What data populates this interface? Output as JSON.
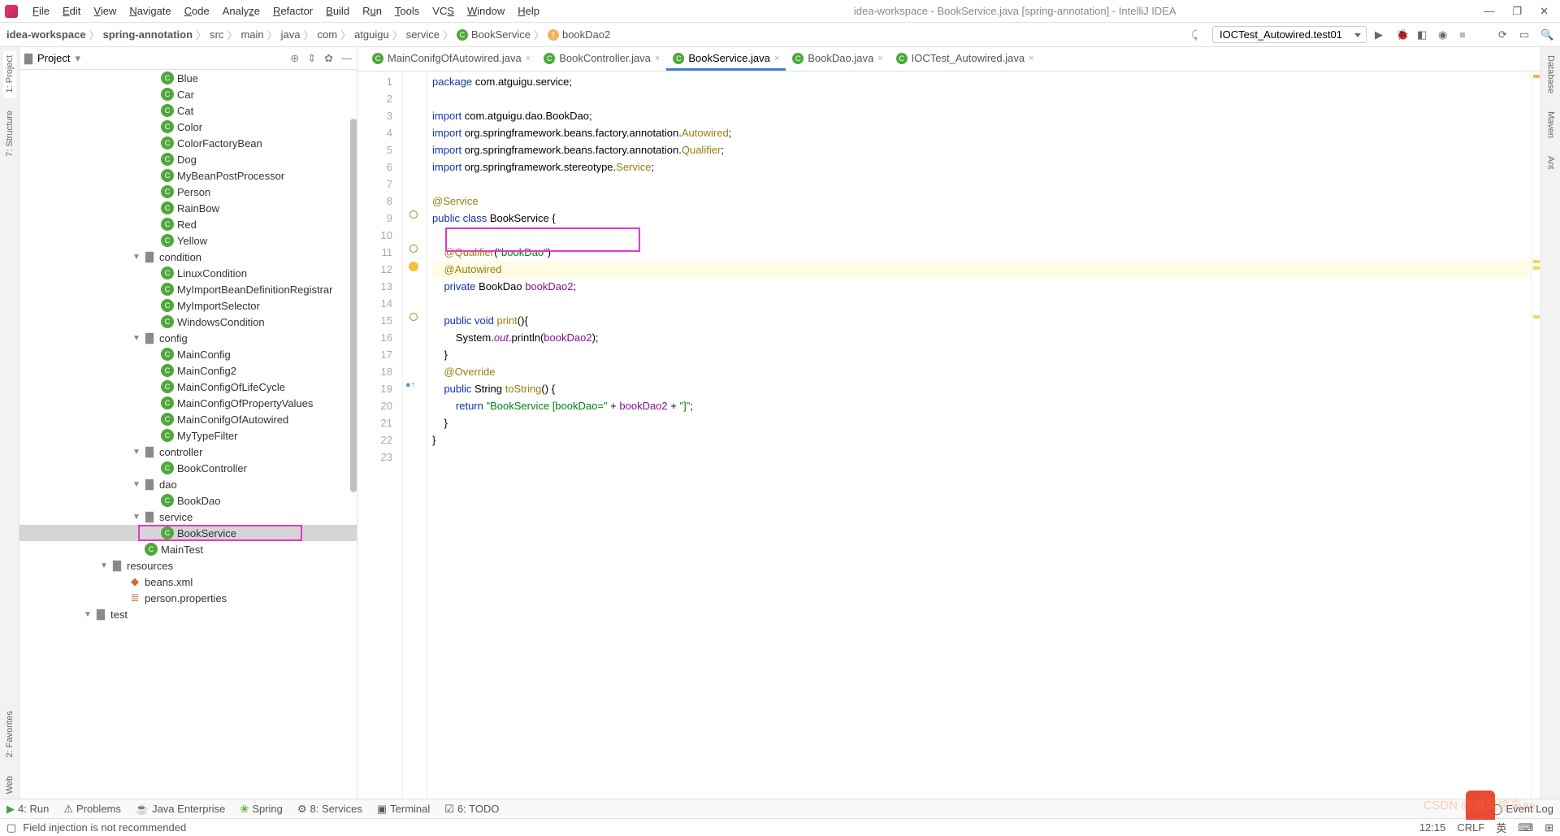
{
  "title": "idea-workspace - BookService.java [spring-annotation] - IntelliJ IDEA",
  "menu": [
    "File",
    "Edit",
    "View",
    "Navigate",
    "Code",
    "Analyze",
    "Refactor",
    "Build",
    "Run",
    "Tools",
    "VCS",
    "Window",
    "Help"
  ],
  "breadcrumb": [
    "idea-workspace",
    "spring-annotation",
    "src",
    "main",
    "java",
    "com",
    "atguigu",
    "service",
    "BookService",
    "bookDao2"
  ],
  "run_config": "IOCTest_Autowired.test01",
  "project_panel_title": "Project",
  "tree": {
    "bean": [
      "Blue",
      "Car",
      "Cat",
      "Color",
      "ColorFactoryBean",
      "Dog",
      "MyBeanPostProcessor",
      "Person",
      "RainBow",
      "Red",
      "Yellow"
    ],
    "condition_label": "condition",
    "condition": [
      "LinuxCondition",
      "MyImportBeanDefinitionRegistrar",
      "MyImportSelector",
      "WindowsCondition"
    ],
    "config_label": "config",
    "config": [
      "MainConfig",
      "MainConfig2",
      "MainConfigOfLifeCycle",
      "MainConfigOfPropertyValues",
      "MainConifgOfAutowired",
      "MyTypeFilter"
    ],
    "controller_label": "controller",
    "controller": [
      "BookController"
    ],
    "dao_label": "dao",
    "dao": [
      "BookDao"
    ],
    "service_label": "service",
    "service": [
      "BookService"
    ],
    "maintest": "MainTest",
    "resources_label": "resources",
    "resources": [
      "beans.xml",
      "person.properties"
    ],
    "test_label": "test"
  },
  "editor_tabs": [
    {
      "name": "MainConifgOfAutowired.java"
    },
    {
      "name": "BookController.java"
    },
    {
      "name": "BookService.java",
      "active": true
    },
    {
      "name": "BookDao.java"
    },
    {
      "name": "IOCTest_Autowired.java"
    }
  ],
  "left_tabs": [
    "1: Project",
    "7: Structure",
    "2: Favorites",
    "Web"
  ],
  "right_tabs": [
    "Database",
    "Maven",
    "Ant"
  ],
  "bottom_tools": [
    "4: Run",
    "Problems",
    "Java Enterprise",
    "Spring",
    "8: Services",
    "Terminal",
    "6: TODO"
  ],
  "event_log": "Event Log",
  "status_msg": "Field injection is not recommended",
  "cursor": "12:15",
  "line_ending": "CRLF",
  "code": {
    "l1_a": "package",
    "l1_b": " com.atguigu.service;",
    "l3_a": "import",
    "l3_b": " com.atguigu.dao.BookDao;",
    "l4_a": "import",
    "l4_b": " org.springframework.beans.factory.annotation.",
    "l4_c": "Autowired",
    "l4_d": ";",
    "l5_a": "import",
    "l5_b": " org.springframework.beans.factory.annotation.",
    "l5_c": "Qualifier",
    "l5_d": ";",
    "l6_a": "import",
    "l6_b": " org.springframework.stereotype.",
    "l6_c": "Service",
    "l6_d": ";",
    "l8": "@Service",
    "l9_a": "public class ",
    "l9_b": "BookService {",
    "l11_a": "@Qualifier",
    "l11_b": "(",
    "l11_c": "\"bookDao\"",
    "l11_d": ")",
    "l12": "@Autowired",
    "l13_a": "private ",
    "l13_b": "BookDao ",
    "l13_c": "bookDao2",
    "l13_d": ";",
    "l15_a": "public void ",
    "l15_b": "print",
    "l15_c": "(){",
    "l16_a": "        System.",
    "l16_b": "out",
    "l16_c": ".println(",
    "l16_d": "bookDao2",
    "l16_e": ");",
    "l17": "    }",
    "l18": "@Override",
    "l19_a": "public ",
    "l19_b": "String ",
    "l19_c": "toString",
    "l19_d": "() {",
    "l20_a": "return ",
    "l20_b": "\"BookService [bookDao=\"",
    "l20_c": " + ",
    "l20_d": "bookDao2",
    "l20_e": " + ",
    "l20_f": "\"]\"",
    "l20_g": ";",
    "l21": "    }",
    "l22": "}"
  },
  "watermark": "CSDN @清风徐来ae"
}
